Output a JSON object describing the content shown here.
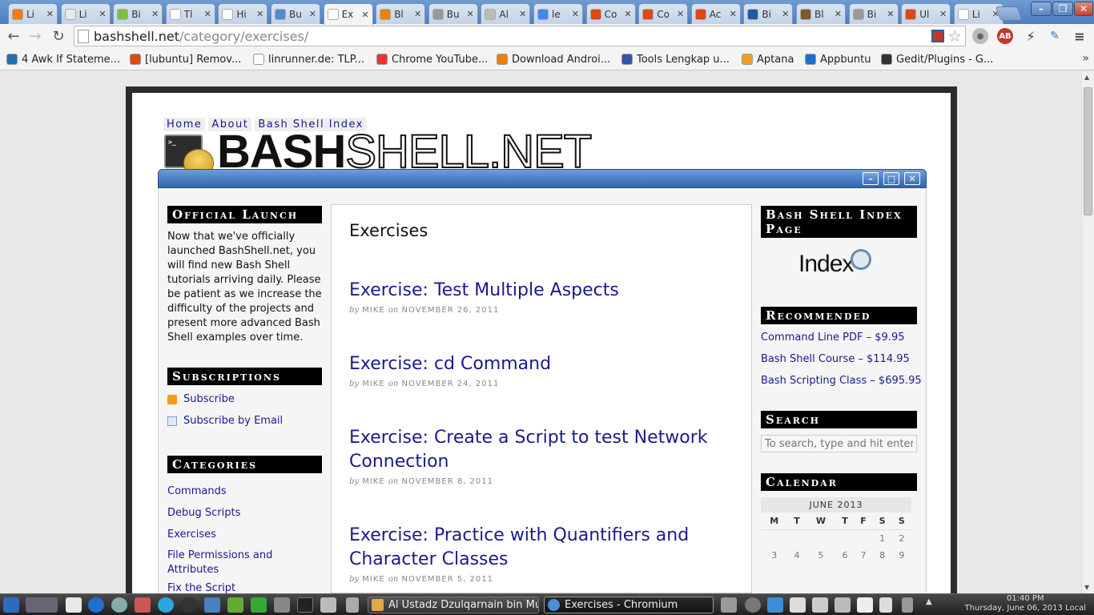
{
  "browser": {
    "tabs": [
      {
        "title": "Li",
        "color": "#f57d00"
      },
      {
        "title": "Li",
        "color": "#e8e8e8"
      },
      {
        "title": "Bi",
        "color": "#7fbf3f"
      },
      {
        "title": "Tl",
        "color": "#ffffff"
      },
      {
        "title": "Hi",
        "color": "#ffffff"
      },
      {
        "title": "Bu",
        "color": "#4c8ed6"
      },
      {
        "title": "Ex",
        "color": "#ffffff",
        "active": true
      },
      {
        "title": "Bl",
        "color": "#f57d00"
      },
      {
        "title": "Bu",
        "color": "#999999"
      },
      {
        "title": "Al",
        "color": "#bbbbbb"
      },
      {
        "title": "le",
        "color": "#4285f4"
      },
      {
        "title": "Co",
        "color": "#dd4814"
      },
      {
        "title": "Co",
        "color": "#dd4814"
      },
      {
        "title": "Ac",
        "color": "#dd4814"
      },
      {
        "title": "Bi",
        "color": "#1f5aa6"
      },
      {
        "title": "Bl",
        "color": "#7a5c2a"
      },
      {
        "title": "Bi",
        "color": "#9a9a9a"
      },
      {
        "title": "Ul",
        "color": "#dd4814"
      },
      {
        "title": "Li",
        "color": "#ffffff"
      }
    ],
    "url_host": "bashshell.net",
    "url_path": "/category/exercises/",
    "bookmarks": [
      {
        "label": "4 Awk If Stateme...",
        "color": "#1f6fb2"
      },
      {
        "label": "[lubuntu] Remov...",
        "color": "#dd4814"
      },
      {
        "label": "linrunner.de: TLP...",
        "color": "#ffffff"
      },
      {
        "label": "Chrome YouTube...",
        "color": "#e33"
      },
      {
        "label": "Download Androi...",
        "color": "#f57d00"
      },
      {
        "label": "Tools Lengkap u...",
        "color": "#3355aa"
      },
      {
        "label": "Aptana",
        "color": "#f0a020"
      },
      {
        "label": "Appbuntu",
        "color": "#1f6fd2"
      },
      {
        "label": "Gedit/Plugins - G...",
        "color": "#333333"
      }
    ]
  },
  "site": {
    "nav": [
      "Home",
      "About",
      "Bash Shell Index"
    ],
    "logo_bold": "BASH",
    "logo_thin": "SHELL.NET",
    "logo_term": ">_"
  },
  "left": {
    "launch_title": "Official Launch",
    "launch_text": "Now that we've officially launched BashShell.net, you will find new Bash Shell tutorials arriving daily. Please be patient as we increase the difficulty of the projects and present more advanced Bash Shell examples over time.",
    "subs_title": "Subscriptions",
    "subscribe": "Subscribe",
    "subscribe_email": "Subscribe by Email",
    "cat_title": "Categories",
    "categories": [
      "Commands",
      "Debug Scripts",
      "Exercises",
      "File Permissions and Attributes",
      "Fix the Script"
    ]
  },
  "main": {
    "title": "Exercises",
    "posts": [
      {
        "title": "Exercise: Test Multiple Aspects",
        "by": "by",
        "author": "MIKE",
        "on": "on",
        "date": "NOVEMBER 26, 2011"
      },
      {
        "title": "Exercise: cd Command",
        "by": "by",
        "author": "MIKE",
        "on": "on",
        "date": "NOVEMBER 24, 2011"
      },
      {
        "title": "Exercise: Create a Script to test Network Connection",
        "by": "by",
        "author": "MIKE",
        "on": "on",
        "date": "NOVEMBER 8, 2011"
      },
      {
        "title": "Exercise: Practice with Quantifiers and Character Classes",
        "by": "by",
        "author": "MIKE",
        "on": "on",
        "date": "NOVEMBER 5, 2011"
      }
    ]
  },
  "right": {
    "index_title": "Bash Shell Index Page",
    "index_logo": "Index",
    "rec_title": "Recommended",
    "recommended": [
      "Command Line PDF – $9.95",
      "Bash Shell Course – $114.95",
      "Bash Scripting Class – $695.95"
    ],
    "search_title": "Search",
    "search_placeholder": "To search, type and hit enter",
    "cal_title": "Calendar",
    "cal_caption": "JUNE 2013",
    "cal_days": [
      "M",
      "T",
      "W",
      "T",
      "F",
      "S",
      "S"
    ],
    "cal_row1": [
      "",
      "",
      "",
      "",
      "",
      "1",
      "2"
    ],
    "cal_row2": [
      "3",
      "4",
      "5",
      "6",
      "7",
      "8",
      "9"
    ]
  },
  "taskbar": {
    "task1": "Al Ustadz Dzulqarnain bin Muh",
    "task2": "Exercises - Chromium",
    "time": "01:40 PM",
    "date": "Thursday, June 06, 2013 Local"
  }
}
